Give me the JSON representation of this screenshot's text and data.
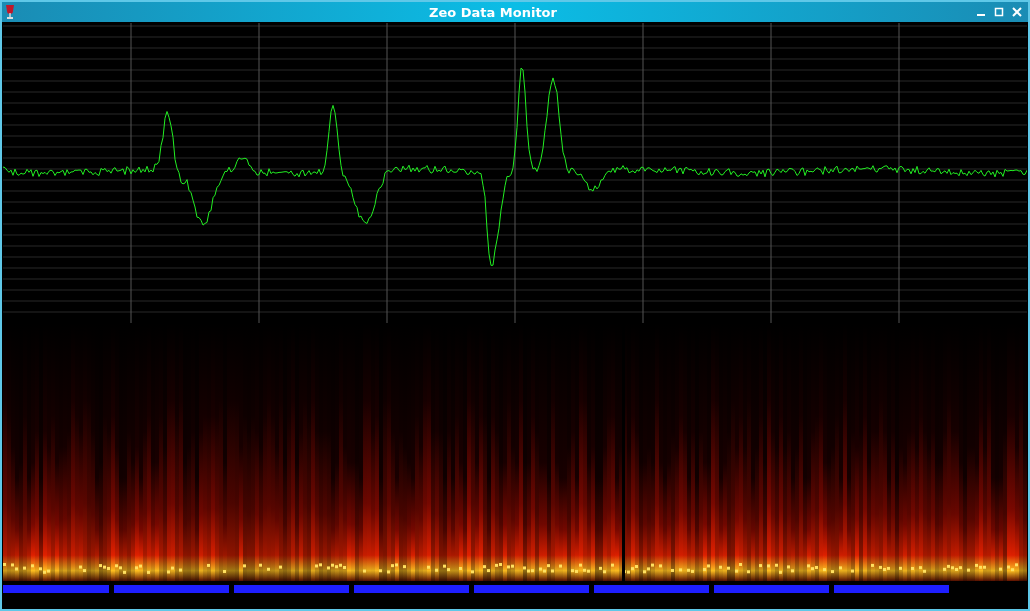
{
  "window": {
    "title": "Zeo Data Monitor"
  }
}
